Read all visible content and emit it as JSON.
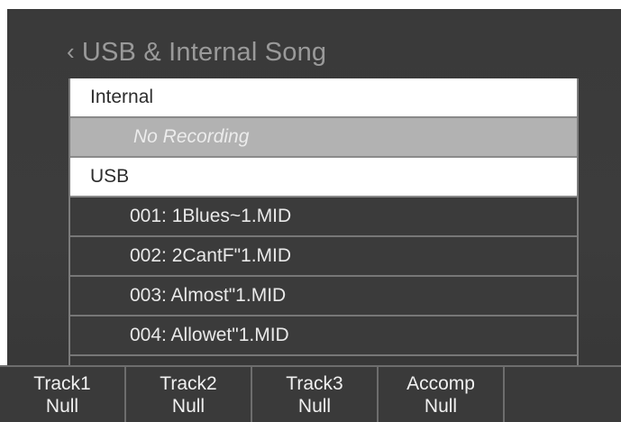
{
  "header": {
    "back_symbol": "‹",
    "title": "USB & Internal Song"
  },
  "list": {
    "internal_label": "Internal",
    "no_recording": "No Recording",
    "usb_label": "USB",
    "files": [
      "001: 1Blues~1.MID",
      "002: 2CantF\"1.MID",
      "003: Almost\"1.MID",
      "004: Allowet\"1.MID"
    ]
  },
  "softkeys": [
    {
      "label": "Track1",
      "value": "Null"
    },
    {
      "label": "Track2",
      "value": "Null"
    },
    {
      "label": "Track3",
      "value": "Null"
    },
    {
      "label": "Accomp",
      "value": "Null"
    },
    {
      "label": "",
      "value": ""
    }
  ],
  "colors": {
    "screen_bg": "#3b3b3b",
    "section_bg": "#ffffff",
    "empty_row_bg": "#b2b2b2",
    "title_text": "#9a9a9a"
  },
  "icons": {
    "back": "chevron-left-icon"
  }
}
